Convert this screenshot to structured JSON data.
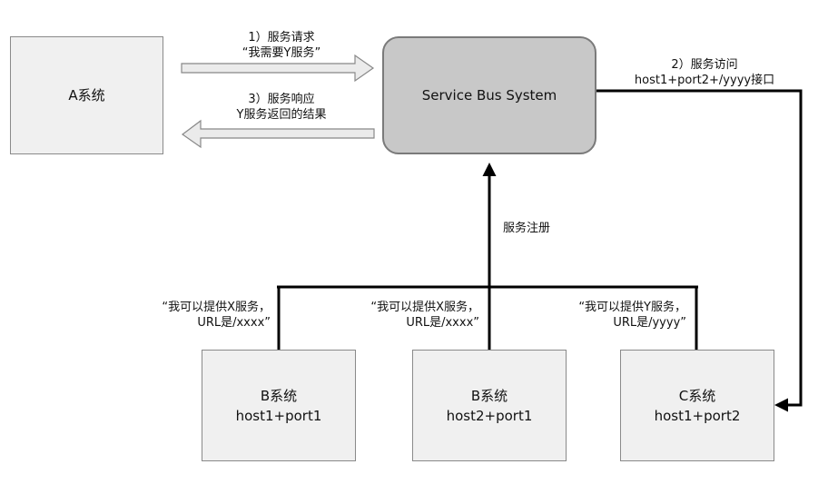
{
  "system_a": {
    "label": "A系统"
  },
  "bus": {
    "label": "Service Bus System"
  },
  "flow_request": {
    "line1": "1）服务请求",
    "line2": "“我需要Y服务”"
  },
  "flow_response": {
    "line1": "3）服务响应",
    "line2": "Y服务返回的结果"
  },
  "flow_access": {
    "line1": "2）服务访问",
    "line2": "host1+port2+/yyyy接口"
  },
  "flow_register": {
    "label": "服务注册"
  },
  "service_b1": {
    "title": "B系统",
    "address": "host1+port1",
    "caption_line1": "“我可以提供X服务，",
    "caption_line2": "URL是/xxxx”"
  },
  "service_b2": {
    "title": "B系统",
    "address": "host2+port1",
    "caption_line1": "“我可以提供X服务，",
    "caption_line2": "URL是/xxxx”"
  },
  "service_c": {
    "title": "C系统",
    "address": "host1+port2",
    "caption_line1": "“我可以提供Y服务，",
    "caption_line2": "URL是/yyyy”"
  }
}
